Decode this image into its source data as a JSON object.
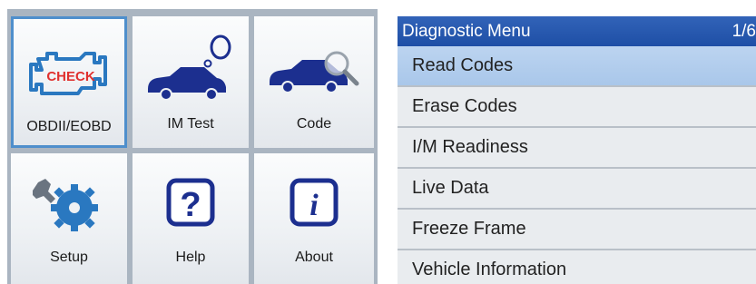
{
  "left_panel": {
    "tiles": [
      {
        "label": "OBDII/EOBD",
        "icon": "engine-check-icon",
        "selected": true
      },
      {
        "label": "IM Test",
        "icon": "car-thought-icon",
        "selected": false
      },
      {
        "label": "Code",
        "icon": "car-magnifier-icon",
        "selected": false
      },
      {
        "label": "Setup",
        "icon": "wrench-gear-icon",
        "selected": false
      },
      {
        "label": "Help",
        "icon": "question-icon",
        "selected": false
      },
      {
        "label": "About",
        "icon": "info-icon",
        "selected": false
      }
    ],
    "check_text": "CHECK",
    "help_glyph": "?",
    "about_glyph": "i"
  },
  "right_panel": {
    "title": "Diagnostic Menu",
    "page": "1/6",
    "items": [
      {
        "label": "Read Codes",
        "highlighted": true
      },
      {
        "label": "Erase Codes",
        "highlighted": false
      },
      {
        "label": "I/M Readiness",
        "highlighted": false
      },
      {
        "label": "Live Data",
        "highlighted": false
      },
      {
        "label": "Freeze Frame",
        "highlighted": false
      },
      {
        "label": "Vehicle Information",
        "highlighted": false
      }
    ]
  },
  "colors": {
    "header_blue": "#2358b0",
    "highlight_blue": "#b3cdee",
    "selection_border": "#4f8fcc",
    "icon_navy": "#1c2f8f",
    "check_red": "#e0302e",
    "gear_blue": "#2a78c0"
  }
}
